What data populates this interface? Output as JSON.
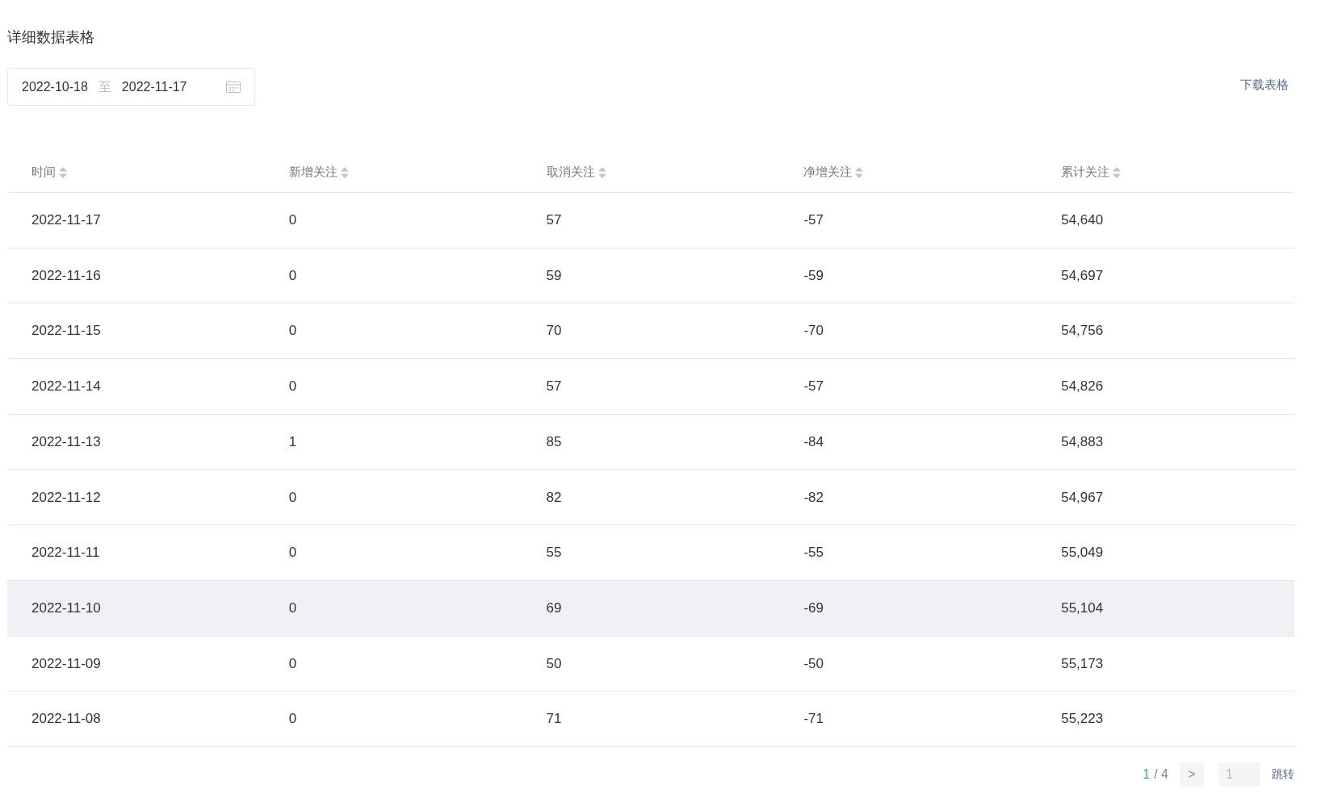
{
  "title": "详细数据表格",
  "date_range": {
    "start": "2022-10-18",
    "separator": "至",
    "end": "2022-11-17"
  },
  "download_link": "下载表格",
  "table": {
    "columns": [
      "时间",
      "新增关注",
      "取消关注",
      "净增关注",
      "累计关注"
    ],
    "rows": [
      {
        "cells": [
          "2022-11-17",
          "0",
          "57",
          "-57",
          "54,640"
        ],
        "hovered": false
      },
      {
        "cells": [
          "2022-11-16",
          "0",
          "59",
          "-59",
          "54,697"
        ],
        "hovered": false
      },
      {
        "cells": [
          "2022-11-15",
          "0",
          "70",
          "-70",
          "54,756"
        ],
        "hovered": false
      },
      {
        "cells": [
          "2022-11-14",
          "0",
          "57",
          "-57",
          "54,826"
        ],
        "hovered": false
      },
      {
        "cells": [
          "2022-11-13",
          "1",
          "85",
          "-84",
          "54,883"
        ],
        "hovered": false
      },
      {
        "cells": [
          "2022-11-12",
          "0",
          "82",
          "-82",
          "54,967"
        ],
        "hovered": false
      },
      {
        "cells": [
          "2022-11-11",
          "0",
          "55",
          "-55",
          "55,049"
        ],
        "hovered": false
      },
      {
        "cells": [
          "2022-11-10",
          "0",
          "69",
          "-69",
          "55,104"
        ],
        "hovered": true
      },
      {
        "cells": [
          "2022-11-09",
          "0",
          "50",
          "-50",
          "55,173"
        ],
        "hovered": false
      },
      {
        "cells": [
          "2022-11-08",
          "0",
          "71",
          "-71",
          "55,223"
        ],
        "hovered": false
      }
    ]
  },
  "pagination": {
    "current": "1",
    "separator": "/ 4",
    "next": ">",
    "jump_placeholder": "1",
    "jump_button": "跳转"
  }
}
